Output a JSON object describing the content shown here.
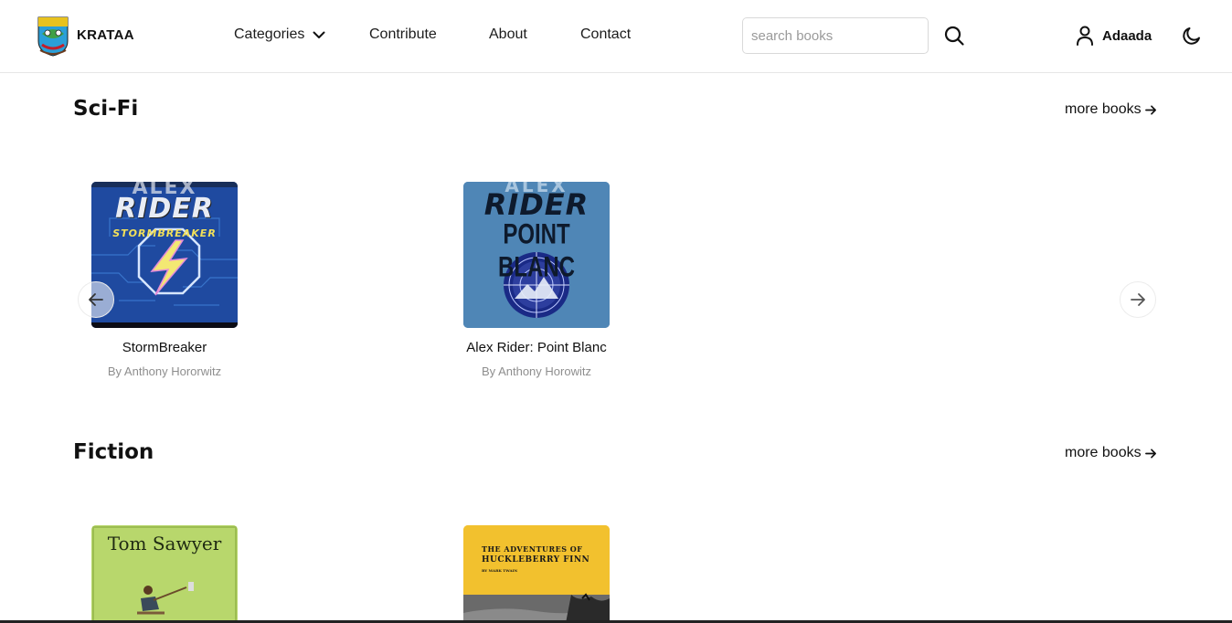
{
  "header": {
    "brand": "KRATAA",
    "nav": {
      "categories": "Categories",
      "contribute": "Contribute",
      "about": "About",
      "contact": "Contact"
    },
    "search": {
      "placeholder": "search books",
      "value": ""
    },
    "user": {
      "name": "Adaada"
    }
  },
  "sections": [
    {
      "title": "Sci-Fi",
      "more_label": "more books",
      "books": [
        {
          "title": "StormBreaker",
          "author": "By Anthony Hororwitz",
          "cover_lines": [
            "ALEX",
            "RIDER",
            "STORMBREAKER"
          ]
        },
        {
          "title": "Alex Rider: Point Blanc",
          "author": "By Anthony Horowitz",
          "cover_lines": [
            "ALEX",
            "RIDER",
            "POINT BLANC"
          ]
        }
      ]
    },
    {
      "title": "Fiction",
      "more_label": "more books",
      "books": [
        {
          "title": "",
          "author": "",
          "cover_lines": [
            "Tom Sawyer"
          ]
        },
        {
          "title": "",
          "author": "",
          "cover_lines": [
            "The Adventures of",
            "Huckleberry Finn",
            "By Mark Twain"
          ]
        }
      ]
    }
  ],
  "colors": {
    "accent_blue": "#1f5fb0",
    "cover_pointblanc": "#4f86b6",
    "cover_tomsawyer": "#b7d66a",
    "cover_huckfinn": "#f2c12e",
    "muted_text": "#8e8e8e"
  },
  "icons": {
    "logo": "krataa-crest",
    "search": "search-icon",
    "user": "user-icon",
    "theme": "moon-icon",
    "categories": "chevron-down-icon",
    "more": "arrow-right-icon",
    "carousel_prev": "arrow-left-icon",
    "carousel_next": "arrow-right-icon"
  }
}
